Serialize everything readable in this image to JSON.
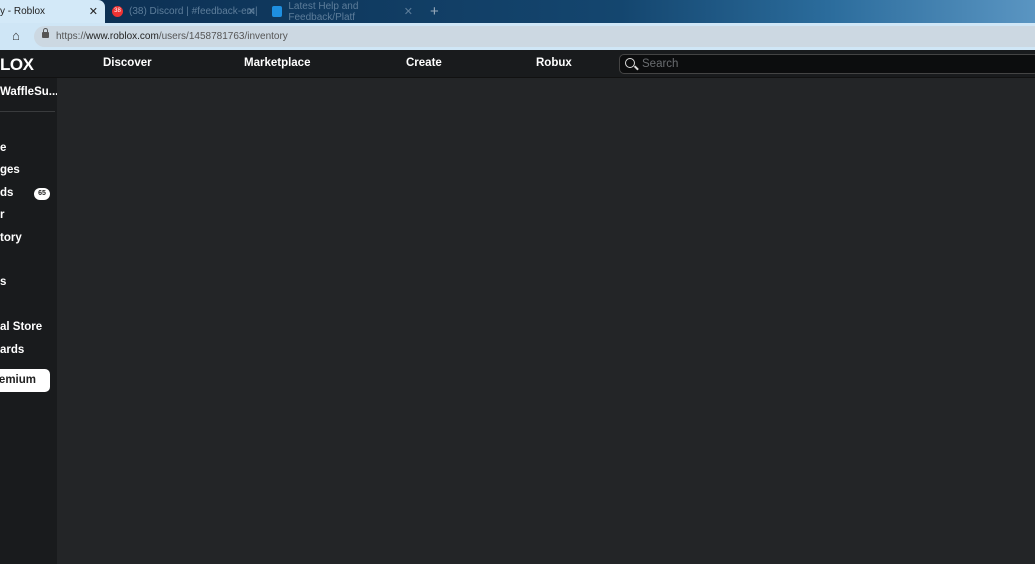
{
  "browser": {
    "tabs": [
      {
        "title": "y - Roblox",
        "close": "✕"
      },
      {
        "title": "(38) Discord | #feedback-em|",
        "close": "✕",
        "badge": "38"
      },
      {
        "title": "Latest Help and Feedback/Platf",
        "close": "✕"
      }
    ],
    "new_tab": "+",
    "url_prefix": "https://",
    "url_domain": "www.roblox.com",
    "url_path": "/users/1458781763/inventory"
  },
  "nav": {
    "logo": "LOX",
    "links": [
      "Discover",
      "Marketplace",
      "Create",
      "Robux"
    ],
    "search_placeholder": "Search"
  },
  "sidebar": {
    "username": "WaffleSu...",
    "items": [
      {
        "label": ""
      },
      {
        "label": "e"
      },
      {
        "label": "ges"
      },
      {
        "label": "ds",
        "badge": "65"
      },
      {
        "label": "r"
      },
      {
        "label": "tory"
      },
      {
        "label": ""
      },
      {
        "label": "s"
      },
      {
        "label": ""
      },
      {
        "label": "al Store"
      },
      {
        "label": "ards"
      }
    ],
    "premium": "emium"
  }
}
